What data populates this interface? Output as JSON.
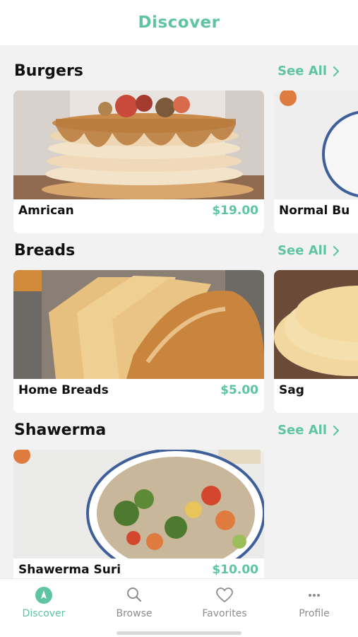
{
  "header": {
    "title": "Discover"
  },
  "sections": [
    {
      "title": "Burgers",
      "see_all": "See All",
      "cards": [
        {
          "name": "Amrican",
          "price": "$19.00"
        },
        {
          "name": "Normal Bu",
          "price": ""
        }
      ]
    },
    {
      "title": "Breads",
      "see_all": "See All",
      "cards": [
        {
          "name": "Home Breads",
          "price": "$5.00"
        },
        {
          "name": "Sag",
          "price": ""
        }
      ]
    },
    {
      "title": "Shawerma",
      "see_all": "See All",
      "cards": [
        {
          "name": "Shawerma Suri",
          "price": "$10.00"
        }
      ]
    }
  ],
  "tabs": [
    {
      "label": "Discover",
      "icon": "compass-icon",
      "active": true
    },
    {
      "label": "Browse",
      "icon": "search-icon",
      "active": false
    },
    {
      "label": "Favorites",
      "icon": "heart-icon",
      "active": false
    },
    {
      "label": "Profile",
      "icon": "more-dots-icon",
      "active": false
    }
  ],
  "colors": {
    "accent": "#5ec4a1",
    "background": "#f2f2f2",
    "tab_inactive": "#8e8e8e"
  }
}
